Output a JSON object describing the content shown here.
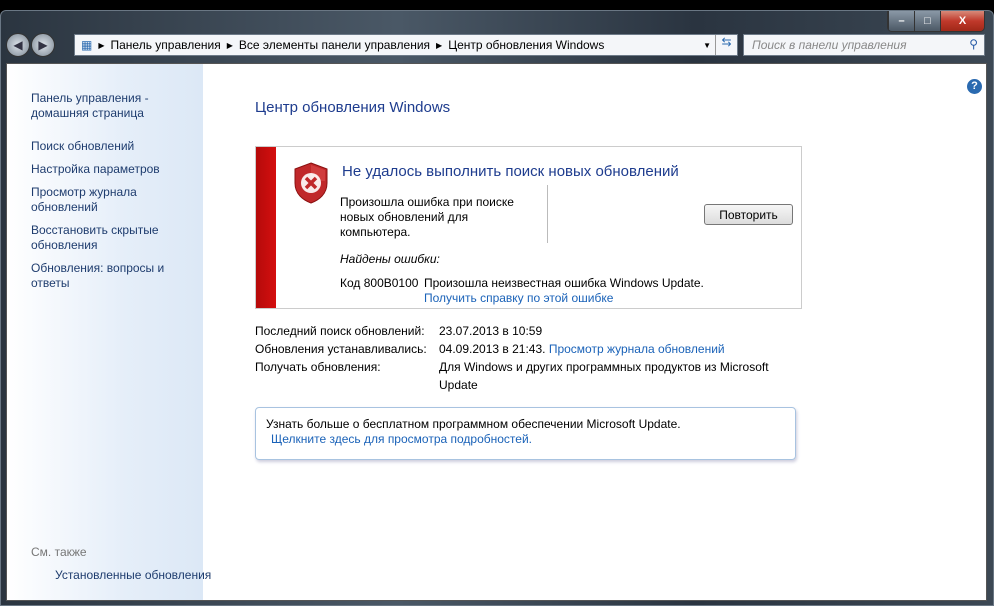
{
  "window": {
    "min": "–",
    "max": "□",
    "close": "X"
  },
  "nav": {
    "back": "◀",
    "forward": "▶"
  },
  "breadcrumb": [
    "Панель управления",
    "Все элементы панели управления",
    "Центр обновления Windows"
  ],
  "search": {
    "placeholder": "Поиск в панели управления"
  },
  "sidebar": {
    "items": [
      "Панель управления - домашняя страница",
      "Поиск обновлений",
      "Настройка параметров",
      "Просмотр журнала обновлений",
      "Восстановить скрытые обновления",
      "Обновления: вопросы и ответы"
    ],
    "see_also": "См. также",
    "installed": "Установленные обновления"
  },
  "main": {
    "title": "Центр обновления Windows",
    "error": {
      "heading": "Не удалось выполнить поиск новых обновлений",
      "description": "Произошла ошибка при поиске новых обновлений для компьютера.",
      "retry": "Повторить",
      "found": "Найдены ошибки:",
      "code": "Код 800B0100",
      "message": "Произошла неизвестная ошибка Windows Update.",
      "help_link": "Получить справку по этой ошибке"
    },
    "info": [
      {
        "label": "Последний поиск обновлений:",
        "value": "23.07.2013 в 10:59"
      },
      {
        "label": "Обновления устанавливались:",
        "value": "04.09.2013 в 21:43.",
        "link": "Просмотр журнала обновлений"
      },
      {
        "label": "Получать обновления:",
        "value": "Для Windows и других программных продуктов из Microsoft Update"
      }
    ],
    "promo": {
      "text": "Узнать больше о бесплатном программном обеспечении Microsoft Update.",
      "link": "Щелкните здесь для просмотра подробностей."
    }
  },
  "colors": {
    "error_bar": "#c80c0c",
    "link": "#1a62b8",
    "title": "#1e3c8e"
  }
}
